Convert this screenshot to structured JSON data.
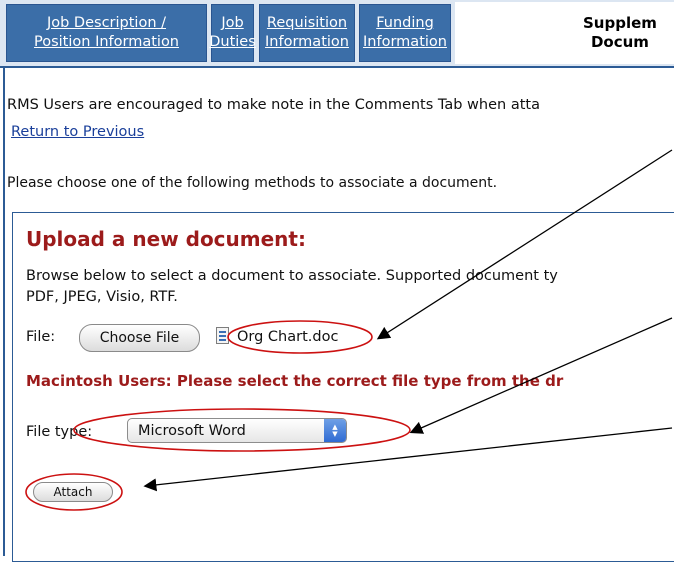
{
  "tabs": [
    {
      "label": "Job Description / Position Information",
      "active": false
    },
    {
      "label": "Job Duties",
      "active": false
    },
    {
      "label": "Requisition Information",
      "active": false
    },
    {
      "label": "Funding Information",
      "active": false
    },
    {
      "label": "Supplem\nDocum",
      "active": true
    }
  ],
  "notice": "RMS Users are encouraged to make note in the Comments Tab when atta",
  "return_link": "Return to Previous",
  "choose_text": "Please choose one of the following methods to associate a document.",
  "upload": {
    "title": "Upload a new document:",
    "browse_text": "Browse below to select a document to associate. Supported document ty\nPDF, JPEG, Visio, RTF.",
    "file_label": "File:",
    "choose_button": "Choose File",
    "file_name": "Org Chart.doc",
    "mac_warning": "Macintosh Users: Please select the correct file type from the dr",
    "file_type_label": "File type:",
    "file_type_value": "Microsoft Word",
    "attach_button": "Attach"
  },
  "annotation_color": "#cc1111"
}
